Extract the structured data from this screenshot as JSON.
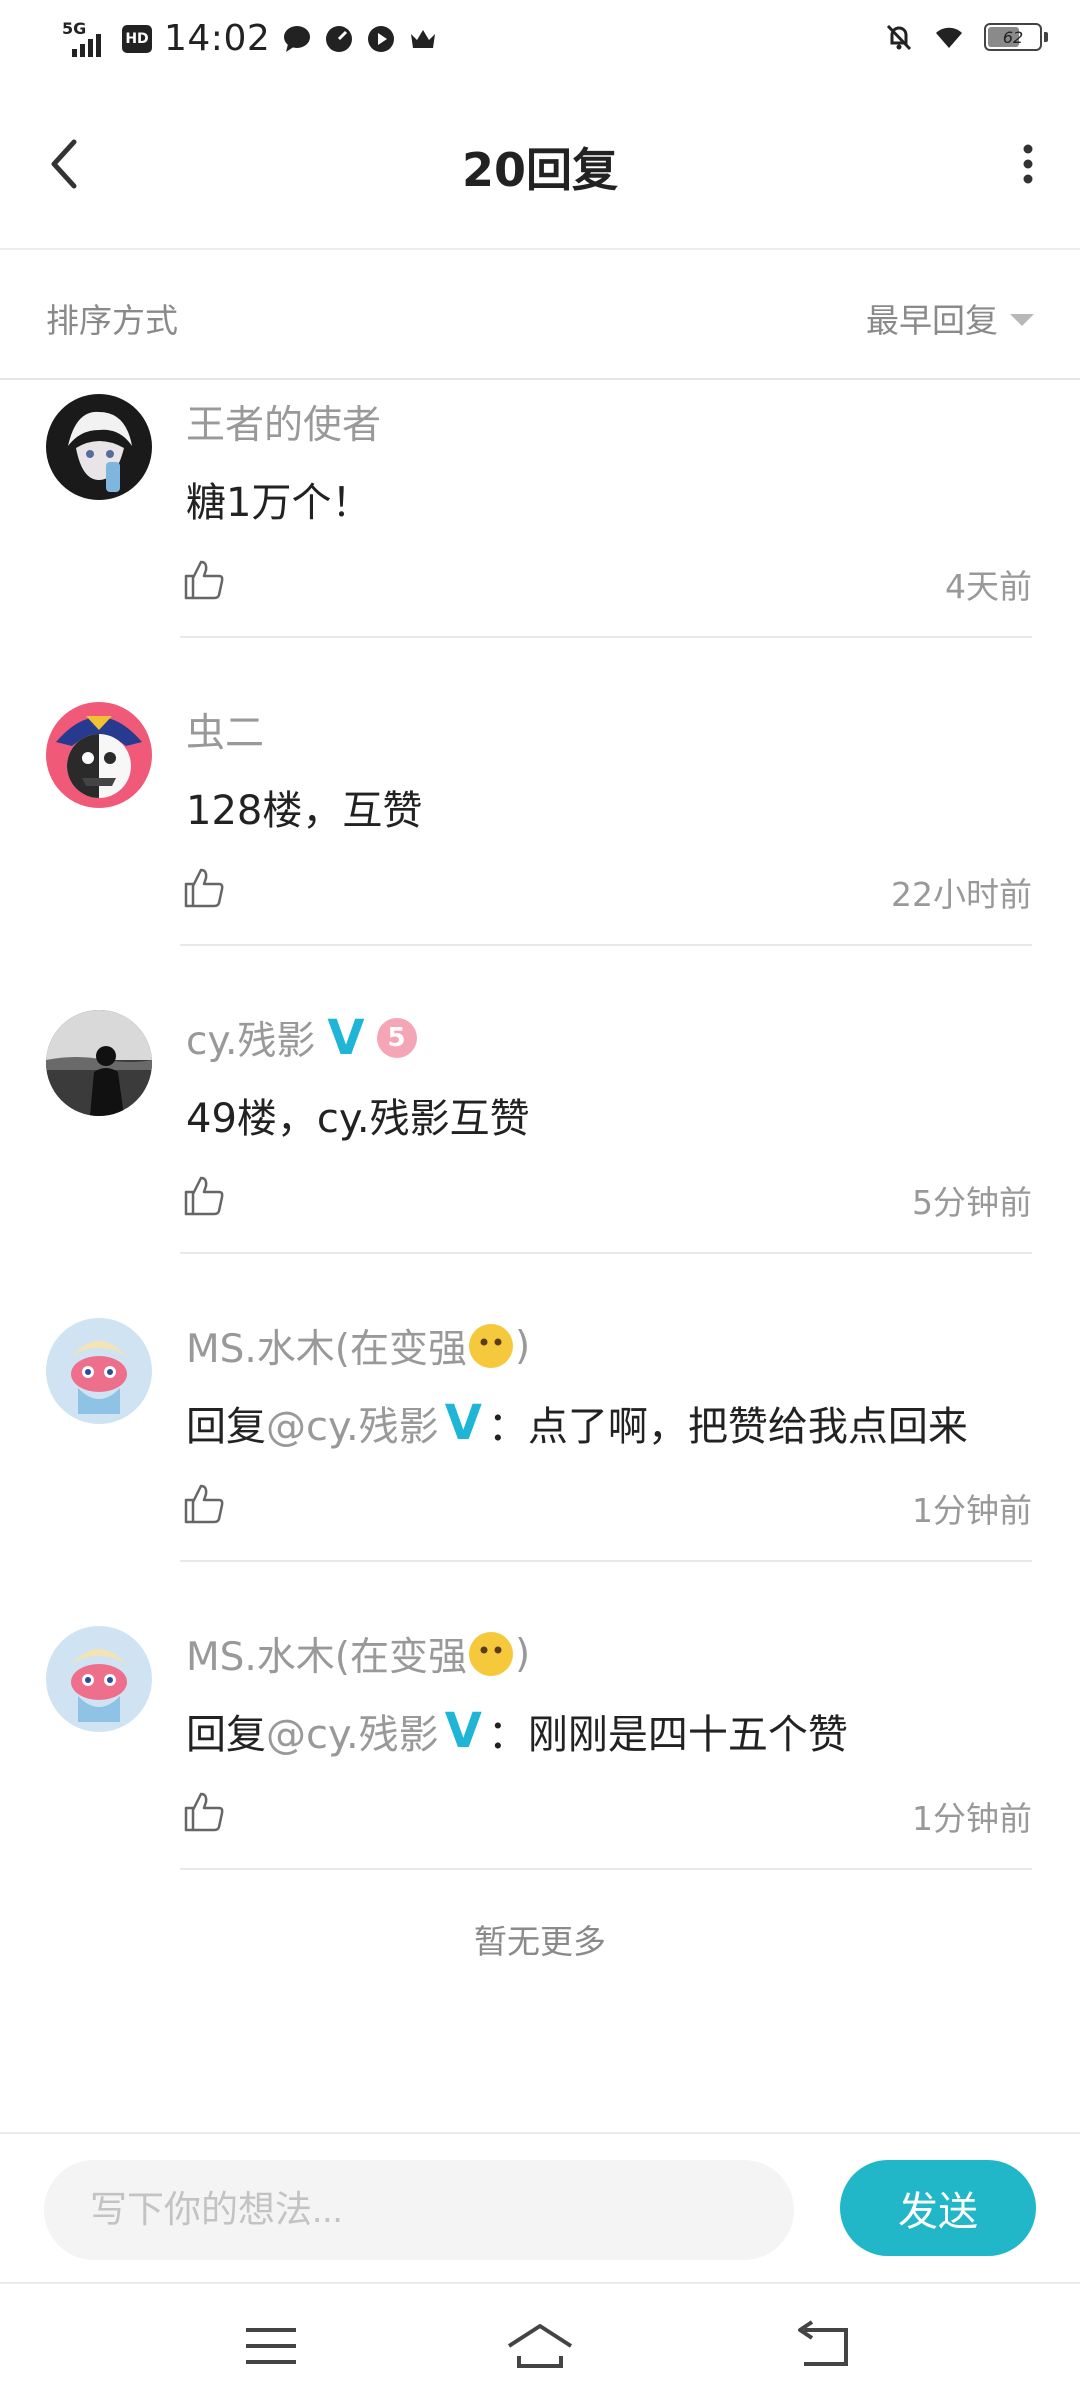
{
  "status_bar": {
    "network": "5G",
    "hd": "HD",
    "time": "14:02",
    "battery": "62",
    "battery_level_percent": 62
  },
  "header": {
    "title": "20回复"
  },
  "sort": {
    "label": "排序方式",
    "value": "最早回复"
  },
  "replies": [
    {
      "name": "王者的使者",
      "content": "糖1万个！",
      "time": "4天前"
    },
    {
      "name": "虫二",
      "content": "128楼，互赞",
      "time": "22小时前"
    },
    {
      "name": "cy.残影",
      "verified_badge": "V",
      "level_badge": "5",
      "content": "49楼，cy.残影互赞",
      "time": "5分钟前"
    },
    {
      "name": "MS.水木(在变强",
      "name_suffix": ")",
      "content_prefix": "回复",
      "mention": "@cy.残影",
      "mention_badge": "V",
      "content": "：点了啊，把赞给我点回来",
      "time": "1分钟前"
    },
    {
      "name": "MS.水木(在变强",
      "name_suffix": ")",
      "content_prefix": "回复",
      "mention": "@cy.残影",
      "mention_badge": "V",
      "content": "：刚刚是四十五个赞",
      "time": "1分钟前"
    }
  ],
  "footer": {
    "no_more": "暂无更多"
  },
  "composer": {
    "placeholder": "写下你的想法...",
    "send_label": "发送"
  },
  "colors": {
    "accent": "#21b7c8",
    "verified": "#1fb5d6"
  }
}
